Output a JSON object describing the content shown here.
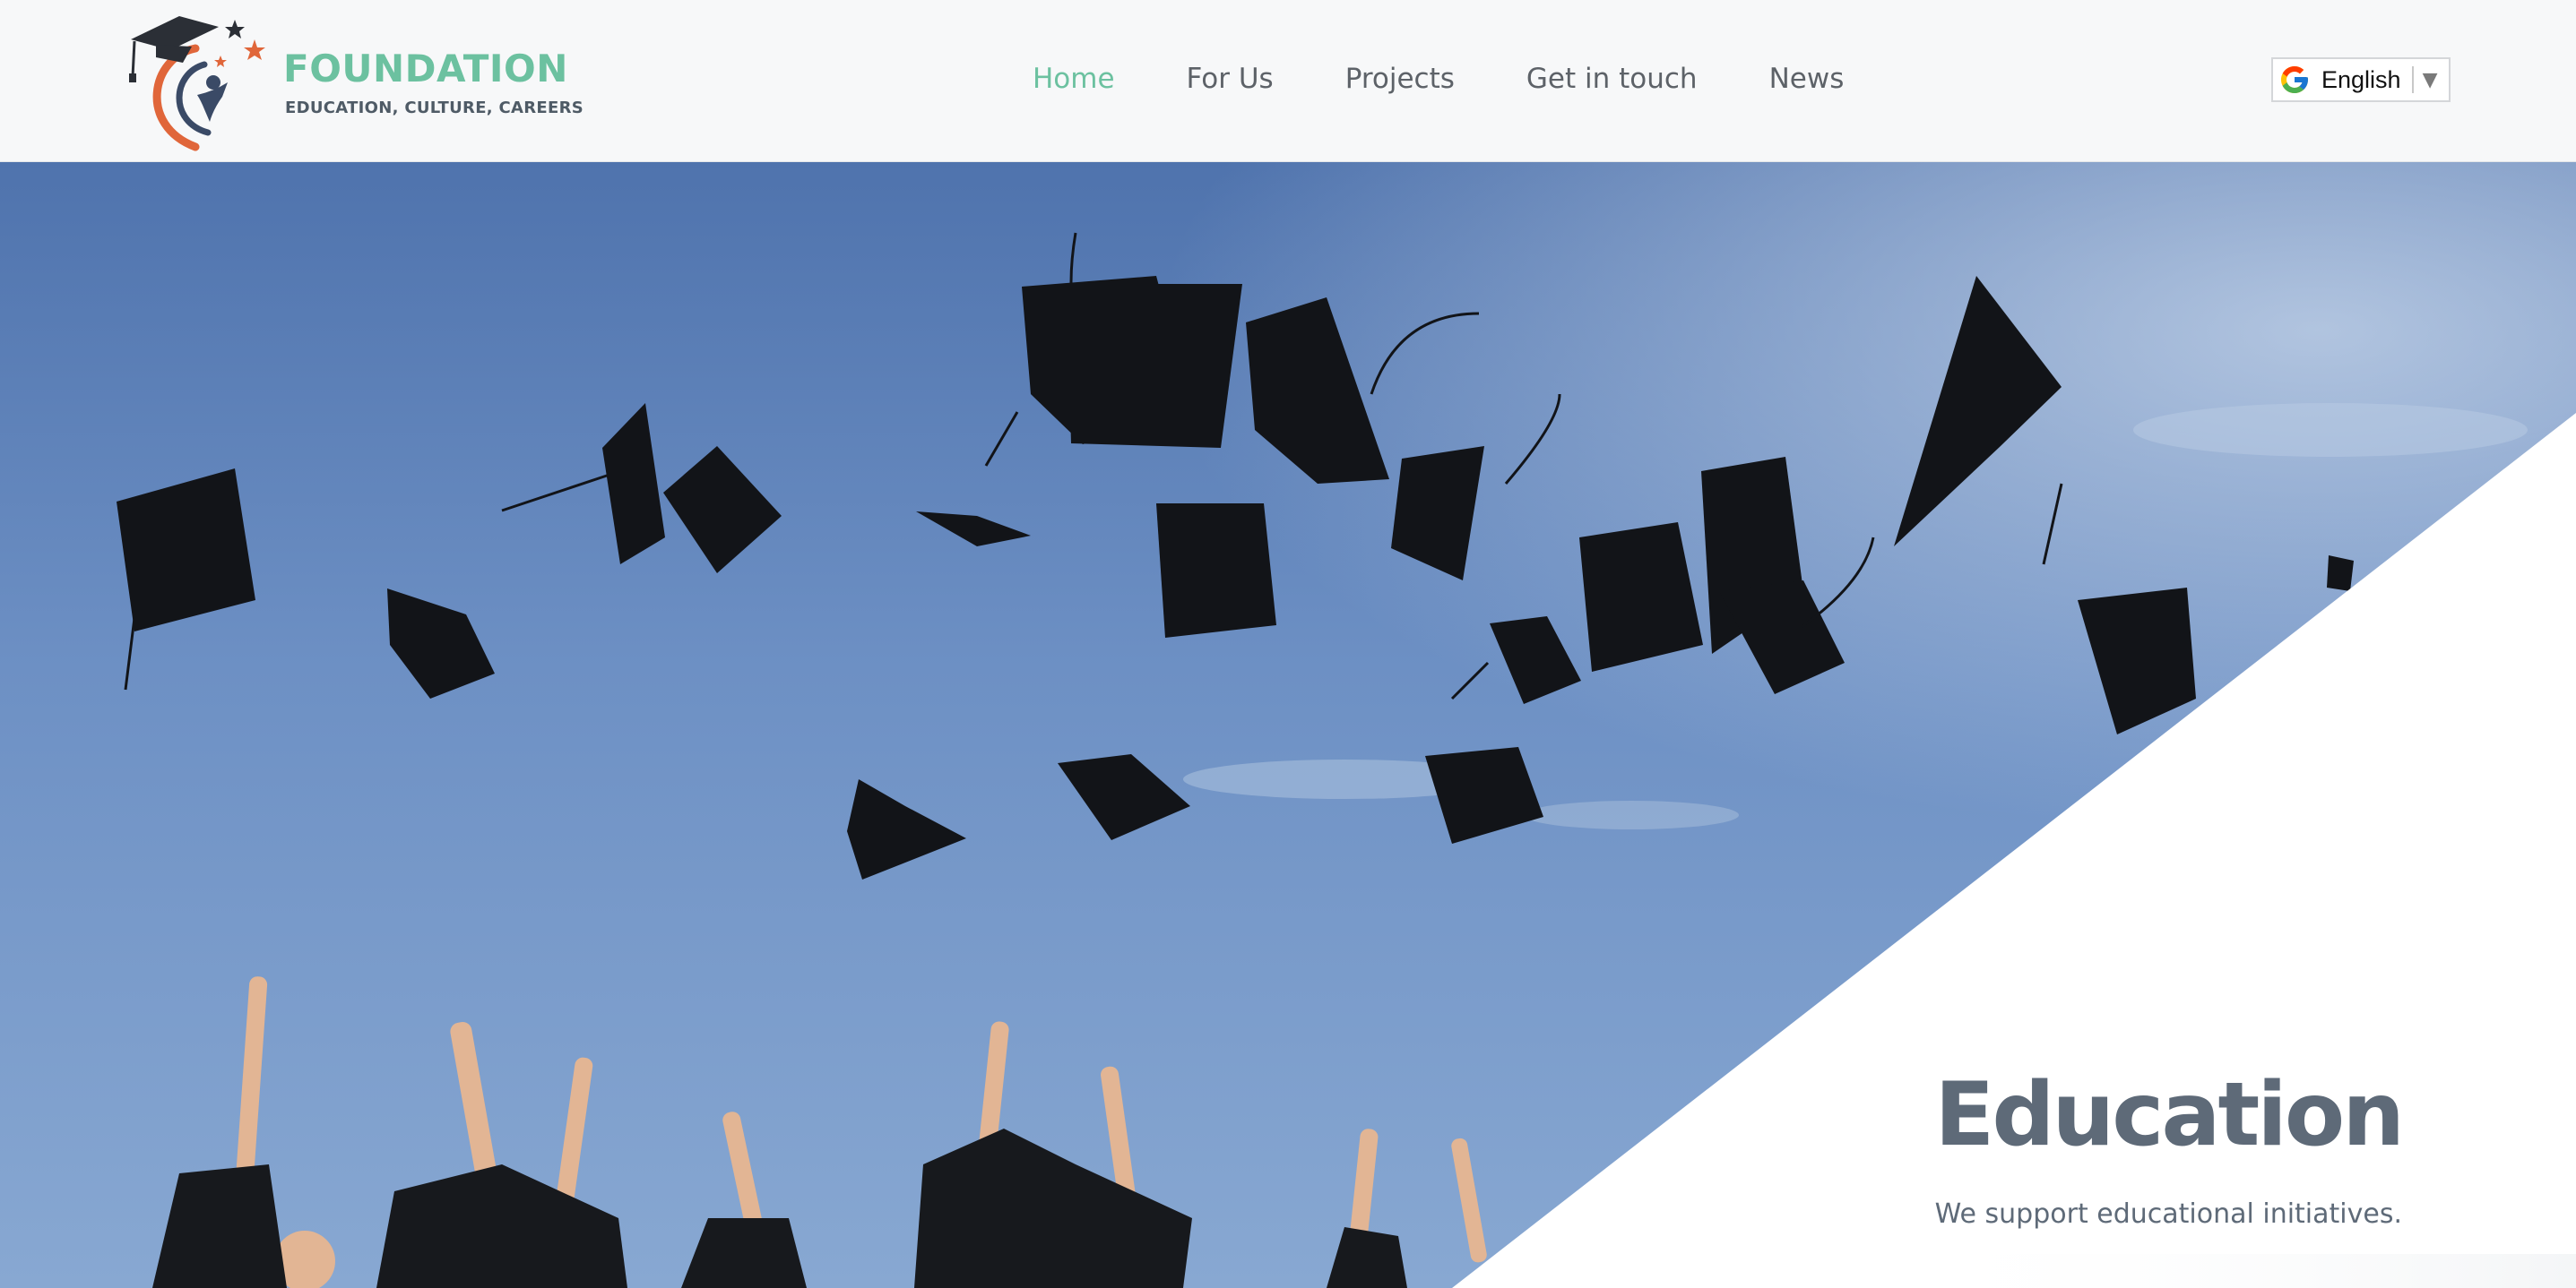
{
  "header": {
    "logo": {
      "title": "FOUNDATION",
      "subtitle": "EDUCATION, CULTURE, CAREERS",
      "icon": "graduation-cap-logo-icon"
    },
    "nav": [
      {
        "label": "Home",
        "active": true
      },
      {
        "label": "For Us",
        "active": false
      },
      {
        "label": "Projects",
        "active": false
      },
      {
        "label": "Get in touch",
        "active": false
      },
      {
        "label": "News",
        "active": false
      }
    ],
    "language": {
      "selected": "English",
      "icon": "google-g-icon",
      "arrow": "▼"
    }
  },
  "hero": {
    "title": "Education",
    "subtitle": "We support educational initiatives."
  },
  "colors": {
    "accent": "#6cc1a0",
    "text_dark": "#5e6a78",
    "nav_text": "#5d6268",
    "logo_orange": "#e0663a",
    "logo_navy": "#3a4a66",
    "sky": "#6f92c4"
  }
}
